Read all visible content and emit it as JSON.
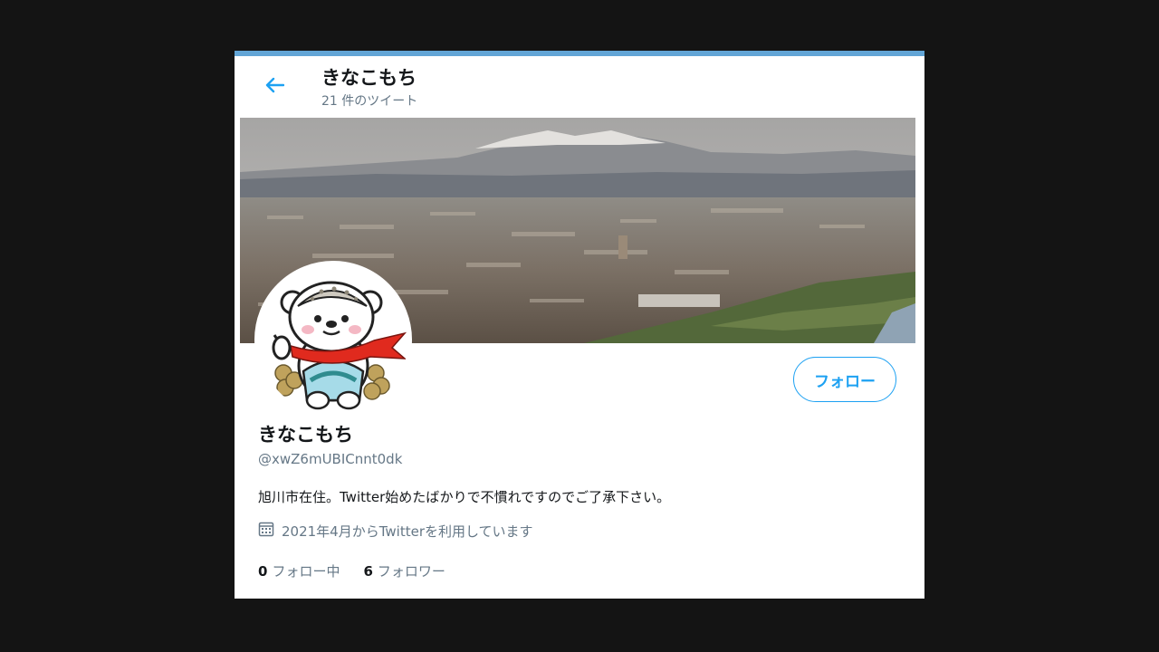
{
  "header": {
    "title": "きなこもち",
    "tweet_count": "21 件のツイート",
    "back_icon": "arrow-left-icon"
  },
  "profile": {
    "display_name": "きなこもち",
    "handle": "@xwZ6mUBICnnt0dk",
    "bio": "旭川市在住。Twitter始めたばかりで不慣れですのでご了承下さい。",
    "joined": "2021年4月からTwitterを利用しています",
    "joined_icon": "calendar-icon",
    "follow_label": "フォロー"
  },
  "stats": {
    "following_count": "0",
    "following_label": "フォロー中",
    "followers_count": "6",
    "followers_label": "フォロワー"
  },
  "colors": {
    "accent": "#1da1f2",
    "muted": "#657786",
    "text": "#14171a",
    "background": "#141414"
  }
}
